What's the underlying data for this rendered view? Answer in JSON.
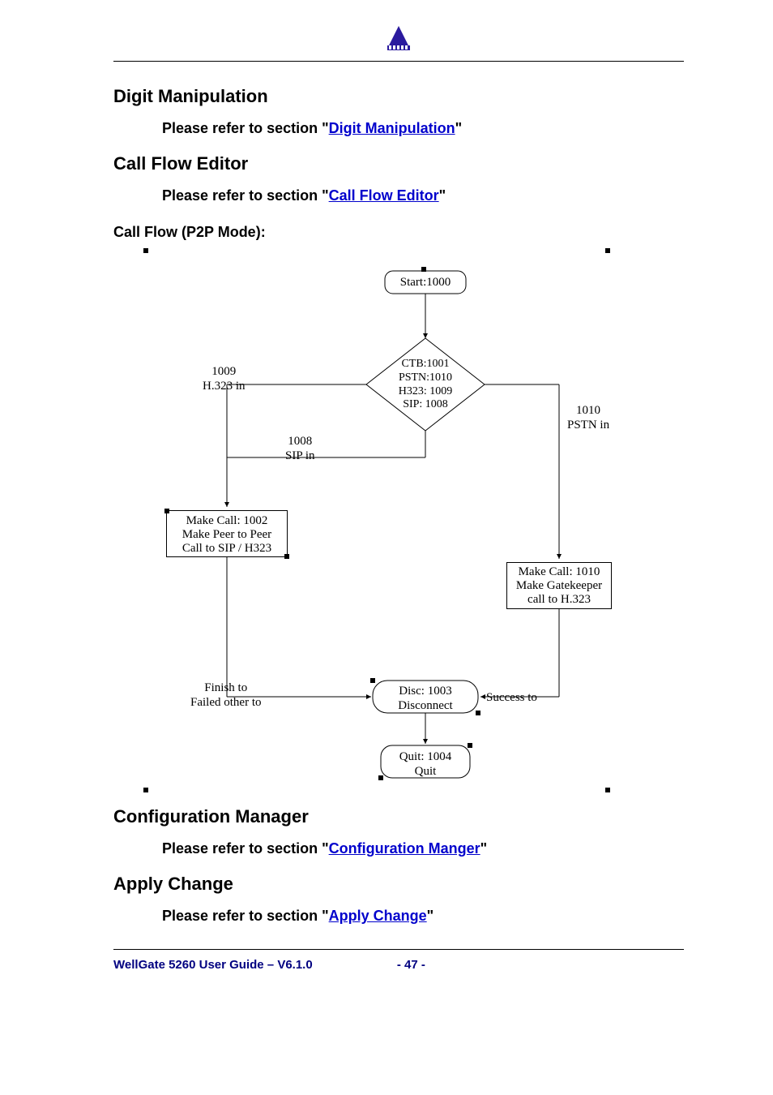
{
  "sections": {
    "digit_manipulation": {
      "heading": "Digit Manipulation",
      "line_prefix": "Please refer to section \"",
      "link": "Digit Manipulation",
      "line_suffix": "\""
    },
    "call_flow_editor": {
      "heading": "Call Flow Editor",
      "line_prefix": "Please refer to section \"",
      "link": "Call Flow Editor",
      "line_suffix": "\""
    },
    "call_flow_sub": "Call Flow (P2P Mode):",
    "config_manager": {
      "heading": "Configuration Manager",
      "line_prefix": "Please refer to section \"",
      "link": "Configuration Manger",
      "line_suffix": "\""
    },
    "apply_change": {
      "heading": "Apply Change",
      "line_prefix": "Please refer to section \"",
      "link": "Apply Change",
      "line_suffix": "\""
    }
  },
  "diagram": {
    "start": "Start:1000",
    "ctb": "CTB:1001\nPSTN:1010\nH323: 1009\nSIP: 1008",
    "left_in": "1009\nH.323 in",
    "sip_in": "1008\nSIP in",
    "pstn_in": "1010\nPSTN in",
    "make_call_left": "Make Call: 1002\nMake Peer to Peer\nCall to SIP / H323",
    "make_call_right": "Make Call: 1010\nMake Gatekeeper\ncall to H.323",
    "finish": "Finish to\nFailed other to",
    "success": "Success to",
    "disc": "Disc: 1003\nDisconnect",
    "quit": "Quit: 1004\nQuit"
  },
  "footer": {
    "left": "WellGate 5260 User Guide – V6.1.0",
    "page": "- 47 -"
  }
}
